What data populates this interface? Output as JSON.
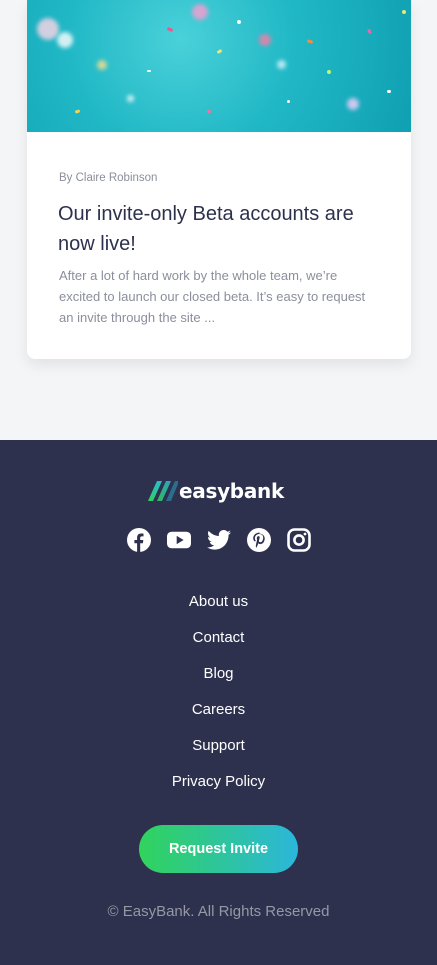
{
  "article": {
    "author": "By Claire Robinson",
    "title": "Our invite-only Beta accounts are now live!",
    "excerpt": "After a lot of hard work by the whole team, we’re excited to launch our closed beta. It’s easy to request an invite through the site ..."
  },
  "footer": {
    "logo_text": "easybank",
    "social_icons": [
      "facebook-icon",
      "youtube-icon",
      "twitter-icon",
      "pinterest-icon",
      "instagram-icon"
    ],
    "links": [
      {
        "label": "About us"
      },
      {
        "label": "Contact"
      },
      {
        "label": "Blog"
      },
      {
        "label": "Careers"
      },
      {
        "label": "Support"
      },
      {
        "label": "Privacy Policy"
      }
    ],
    "cta_label": "Request Invite",
    "copyright": "© EasyBank. All Rights Reserved"
  },
  "colors": {
    "footer_bg": "#2d314d",
    "page_bg": "#f4f5f7",
    "accent_green": "#31d35c",
    "accent_cyan": "#2bb7da",
    "text_dark": "#2d314d",
    "text_muted": "#8b8f9c"
  }
}
